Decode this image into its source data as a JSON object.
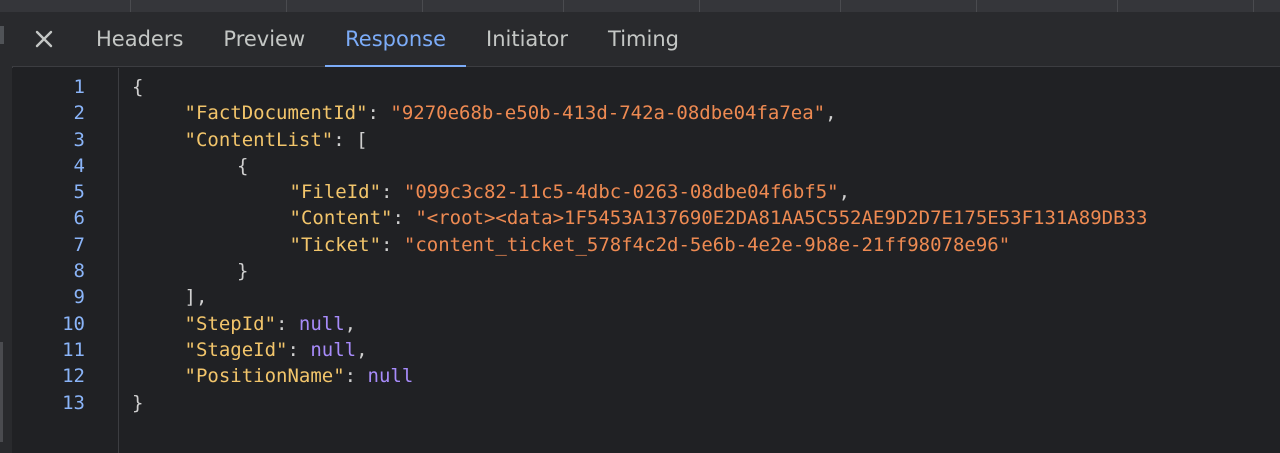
{
  "tabs": [
    "Headers",
    "Preview",
    "Response",
    "Initiator",
    "Timing"
  ],
  "active_tab": "Response",
  "lines": [
    {
      "num": "1",
      "indent": 0,
      "parts": [
        {
          "t": "p",
          "v": "{"
        }
      ]
    },
    {
      "num": "2",
      "indent": 1,
      "parts": [
        {
          "t": "k",
          "v": "\"FactDocumentId\""
        },
        {
          "t": "p",
          "v": ": "
        },
        {
          "t": "s",
          "v": "\"9270e68b-e50b-413d-742a-08dbe04fa7ea\""
        },
        {
          "t": "p",
          "v": ","
        }
      ]
    },
    {
      "num": "3",
      "indent": 1,
      "parts": [
        {
          "t": "k",
          "v": "\"ContentList\""
        },
        {
          "t": "p",
          "v": ": ["
        }
      ]
    },
    {
      "num": "4",
      "indent": 2,
      "parts": [
        {
          "t": "p",
          "v": "{"
        }
      ]
    },
    {
      "num": "5",
      "indent": 3,
      "parts": [
        {
          "t": "k",
          "v": "\"FileId\""
        },
        {
          "t": "p",
          "v": ": "
        },
        {
          "t": "s",
          "v": "\"099c3c82-11c5-4dbc-0263-08dbe04f6bf5\""
        },
        {
          "t": "p",
          "v": ","
        }
      ]
    },
    {
      "num": "6",
      "indent": 3,
      "parts": [
        {
          "t": "k",
          "v": "\"Content\""
        },
        {
          "t": "p",
          "v": ": "
        },
        {
          "t": "s",
          "v": "\"<root><data>1F5453A137690E2DA81AA5C552AE9D2D7E175E53F131A89DB33"
        }
      ]
    },
    {
      "num": "7",
      "indent": 3,
      "parts": [
        {
          "t": "k",
          "v": "\"Ticket\""
        },
        {
          "t": "p",
          "v": ": "
        },
        {
          "t": "s",
          "v": "\"content_ticket_578f4c2d-5e6b-4e2e-9b8e-21ff98078e96\""
        }
      ]
    },
    {
      "num": "8",
      "indent": 2,
      "parts": [
        {
          "t": "p",
          "v": "}"
        }
      ]
    },
    {
      "num": "9",
      "indent": 1,
      "parts": [
        {
          "t": "p",
          "v": "],"
        }
      ]
    },
    {
      "num": "10",
      "indent": 1,
      "parts": [
        {
          "t": "k",
          "v": "\"StepId\""
        },
        {
          "t": "p",
          "v": ": "
        },
        {
          "t": "n",
          "v": "null"
        },
        {
          "t": "p",
          "v": ","
        }
      ]
    },
    {
      "num": "11",
      "indent": 1,
      "parts": [
        {
          "t": "k",
          "v": "\"StageId\""
        },
        {
          "t": "p",
          "v": ": "
        },
        {
          "t": "n",
          "v": "null"
        },
        {
          "t": "p",
          "v": ","
        }
      ]
    },
    {
      "num": "12",
      "indent": 1,
      "parts": [
        {
          "t": "k",
          "v": "\"PositionName\""
        },
        {
          "t": "p",
          "v": ": "
        },
        {
          "t": "n",
          "v": "null"
        }
      ]
    },
    {
      "num": "13",
      "indent": 0,
      "parts": [
        {
          "t": "p",
          "v": "}"
        }
      ]
    }
  ]
}
